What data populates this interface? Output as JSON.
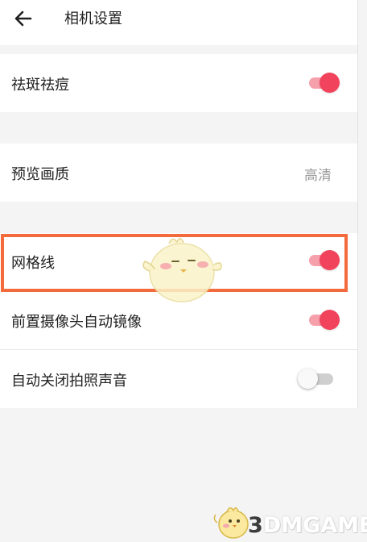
{
  "header": {
    "title": "相机设置",
    "back_icon": "arrow-left-icon"
  },
  "settings": [
    {
      "label": "祛斑祛痘",
      "type": "toggle",
      "enabled": true
    },
    {
      "label": "预览画质",
      "type": "value",
      "value": "高清"
    },
    {
      "label": "网格线",
      "type": "toggle",
      "enabled": true,
      "highlighted": true
    },
    {
      "label": "前置摄像头自动镜像",
      "type": "toggle",
      "enabled": true
    },
    {
      "label": "自动关闭拍照声音",
      "type": "toggle",
      "enabled": false
    }
  ],
  "colors": {
    "accent": "#f2435d",
    "accent_light": "#f6a0ac",
    "highlight": "#f36a3c",
    "background": "#f4f4f4"
  },
  "watermark": {
    "prefix": "3",
    "text": "DMGAME"
  }
}
